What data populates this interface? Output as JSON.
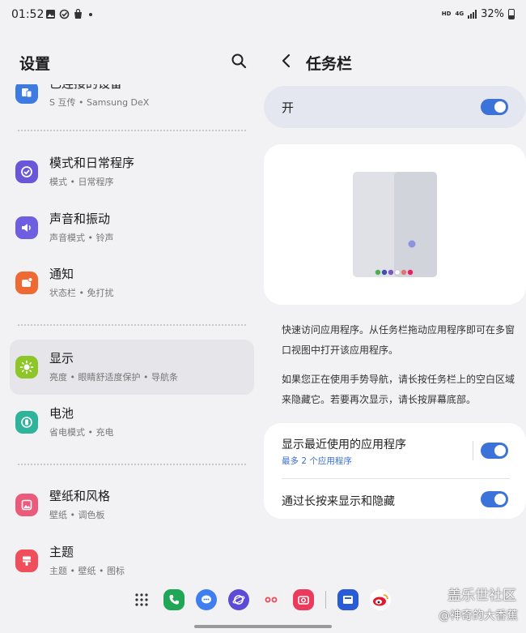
{
  "status_bar": {
    "time": "01:52",
    "right_text": "HD",
    "net_text": "4G",
    "battery": "32%"
  },
  "left": {
    "title": "设置",
    "items": [
      {
        "title": "已连接的设备",
        "subtitle": "S 互传 • Samsung DeX",
        "icon": "connected-devices-icon",
        "color": "#3d7be0"
      },
      {
        "title": "模式和日常程序",
        "subtitle": "模式 • 日常程序",
        "icon": "modes-routines-icon",
        "color": "#6a56d8"
      },
      {
        "title": "声音和振动",
        "subtitle": "声音模式 • 铃声",
        "icon": "sound-icon",
        "color": "#6d5fe0"
      },
      {
        "title": "通知",
        "subtitle": "状态栏 • 免打扰",
        "icon": "notification-icon",
        "color": "#ef6a33"
      },
      {
        "title": "显示",
        "subtitle": "亮度 • 眼睛舒适度保护 • 导航条",
        "icon": "display-icon",
        "color": "#8ec62a"
      },
      {
        "title": "电池",
        "subtitle": "省电模式 • 充电",
        "icon": "battery-icon",
        "color": "#2fb39a"
      },
      {
        "title": "壁纸和风格",
        "subtitle": "壁纸 • 调色板",
        "icon": "wallpaper-icon",
        "color": "#ec5a7b"
      },
      {
        "title": "主题",
        "subtitle": "主题 • 壁纸 • 图标",
        "icon": "themes-icon",
        "color": "#ee4f5b"
      }
    ]
  },
  "right": {
    "title": "任务栏",
    "main_switch_label": "开",
    "main_switch_on": true,
    "description_1": "快速访问应用程序。从任务栏拖动应用程序即可在多窗口视图中打开该应用程序。",
    "description_2": "如果您正在使用手势导航，请长按任务栏上的空白区域来隐藏它。若要再次显示，请长按屏幕底部。",
    "options": [
      {
        "title": "显示最近使用的应用程序",
        "subtitle": "最多 2 个应用程序",
        "on": true
      },
      {
        "title": "通过长按来显示和隐藏",
        "on": true
      }
    ]
  },
  "preview_dots": [
    "#4caf50",
    "#3f51b5",
    "#7e57c2",
    "#ffffff",
    "#e57373",
    "#e91e63"
  ],
  "dock": [
    "apps-grid-icon",
    "phone-icon",
    "messages-icon",
    "internet-icon",
    "game-icon",
    "camera-icon",
    "gallery-icon",
    "weibo-icon"
  ],
  "watermark": {
    "line1": "盖乐世社区",
    "line2": "@神奇的大香蕉"
  }
}
